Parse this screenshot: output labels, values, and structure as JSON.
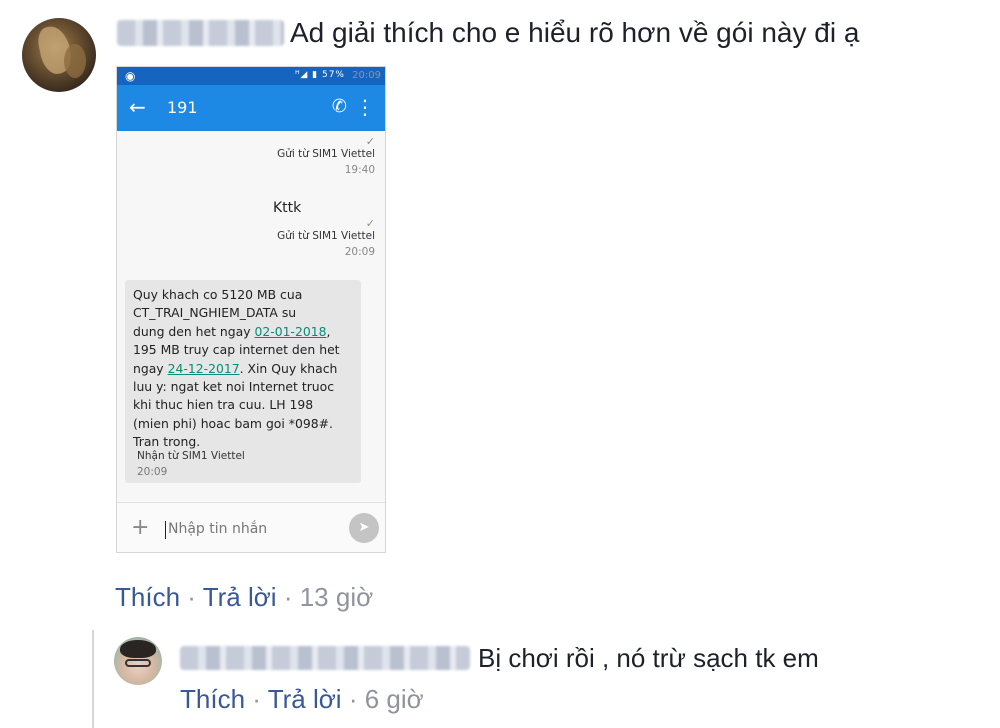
{
  "comment": {
    "text": "Ad giải thích cho e hiểu rõ hơn về gói này đi ạ",
    "actions": {
      "like": "Thích",
      "separator": "·",
      "reply": "Trả lời",
      "time": "13 giờ"
    }
  },
  "phone": {
    "status_bar": {
      "battery": "57%",
      "time": "20:09"
    },
    "app_bar": {
      "title": "191"
    },
    "messages": [
      {
        "direction": "sent",
        "text": "",
        "via": "Gửi từ SIM1 Viettel",
        "time": "19:40"
      },
      {
        "direction": "sent",
        "text": "Kttk",
        "via": "Gửi từ SIM1 Viettel",
        "time": "20:09"
      },
      {
        "direction": "received",
        "text_lines": {
          "l1": "Quy khach co 5120 MB cua",
          "l2": "CT_TRAI_NGHIEM_DATA su",
          "l3_prefix": "dung den het ngay ",
          "date1": "02-01-2018",
          "l3_suffix": ",",
          "l4": "195 MB truy cap internet den het",
          "l5_prefix": "ngay ",
          "date2": "24-12-2017",
          "l5_suffix": ". Xin Quy khach",
          "l6": "luu y: ngat ket noi Internet truoc",
          "l7": "khi thuc hien tra cuu. LH 198",
          "l8": "(mien phi) hoac bam goi *098#.",
          "l9": "Tran trong."
        },
        "via": "Nhận từ SIM1 Viettel",
        "time": "20:09"
      }
    ],
    "composer": {
      "placeholder": "Nhập tin nhắn"
    }
  },
  "reply": {
    "text": "Bị chơi rồi , nó trừ sạch tk em",
    "actions": {
      "like": "Thích",
      "separator": "·",
      "reply": "Trả lời",
      "time": "6 giờ"
    }
  },
  "colors": {
    "link": "#385898",
    "meta": "#90949c",
    "status_bar": "#1565c0",
    "app_bar": "#1e88e5",
    "date_link": "#0a8a7a"
  }
}
